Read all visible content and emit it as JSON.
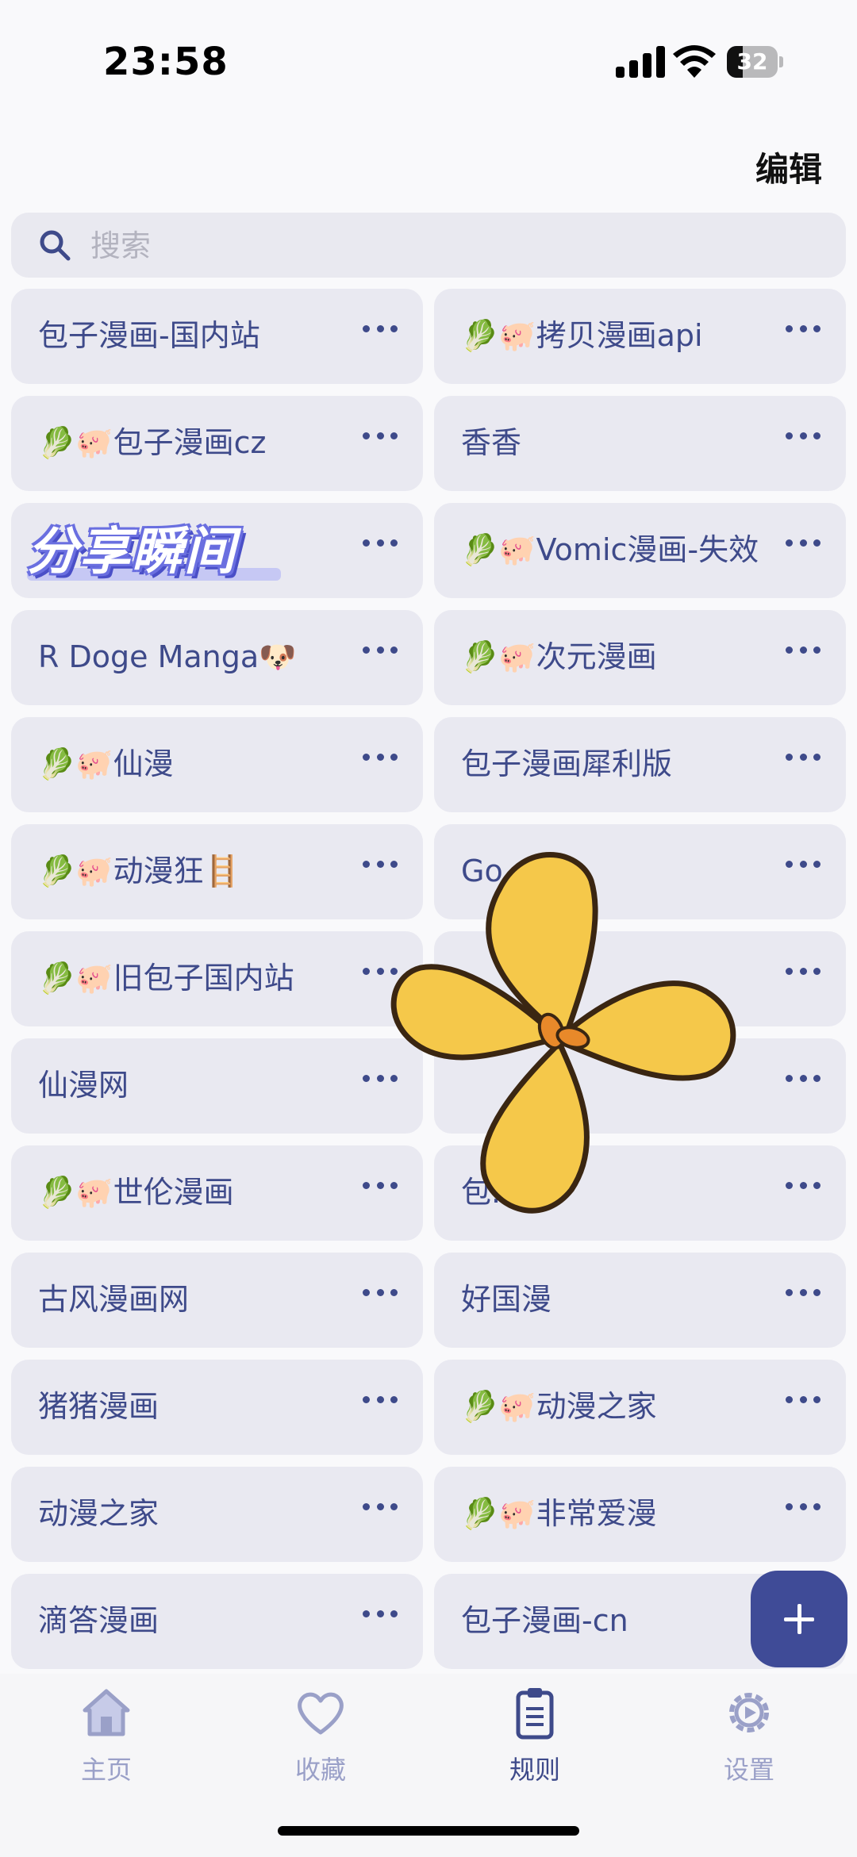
{
  "status_bar": {
    "time": "23:58",
    "battery": "32"
  },
  "header": {
    "edit_label": "编辑"
  },
  "search": {
    "placeholder": "搜索"
  },
  "overlay": {
    "text": "分享瞬间"
  },
  "colors": {
    "accent": "#3f4b97",
    "card_bg": "#e9e9f1",
    "text": "#3e4a8a",
    "inactive_tab": "#9aa0c8"
  },
  "rules": [
    {
      "label": "包子漫画-国内站"
    },
    {
      "label": "🥬🐖拷贝漫画api"
    },
    {
      "label": "🥬🐖包子漫画cz"
    },
    {
      "label": "香香"
    },
    {
      "label": ""
    },
    {
      "label": "🥬🐖Vomic漫画-失效"
    },
    {
      "label": "R Doge Manga🐶"
    },
    {
      "label": "🥬🐖次元漫画"
    },
    {
      "label": "🥬🐖仙漫"
    },
    {
      "label": "包子漫画犀利版"
    },
    {
      "label": "🥬🐖动漫狂🪜"
    },
    {
      "label": "Go...ic"
    },
    {
      "label": "🥬🐖旧包子国内站"
    },
    {
      "label": ""
    },
    {
      "label": "仙漫网"
    },
    {
      "label": ""
    },
    {
      "label": "🥬🐖世伦漫画"
    },
    {
      "label": "包..."
    },
    {
      "label": "古风漫画网"
    },
    {
      "label": "好国漫"
    },
    {
      "label": "猪猪漫画"
    },
    {
      "label": "🥬🐖动漫之家"
    },
    {
      "label": "动漫之家"
    },
    {
      "label": "🥬🐖非常爱漫"
    },
    {
      "label": "滴答漫画"
    },
    {
      "label": "包子漫画-cn"
    }
  ],
  "tabs": [
    {
      "label": "主页",
      "icon": "home-icon"
    },
    {
      "label": "收藏",
      "icon": "heart-icon"
    },
    {
      "label": "规则",
      "icon": "clipboard-icon",
      "active": true
    },
    {
      "label": "设置",
      "icon": "gear-icon"
    }
  ]
}
